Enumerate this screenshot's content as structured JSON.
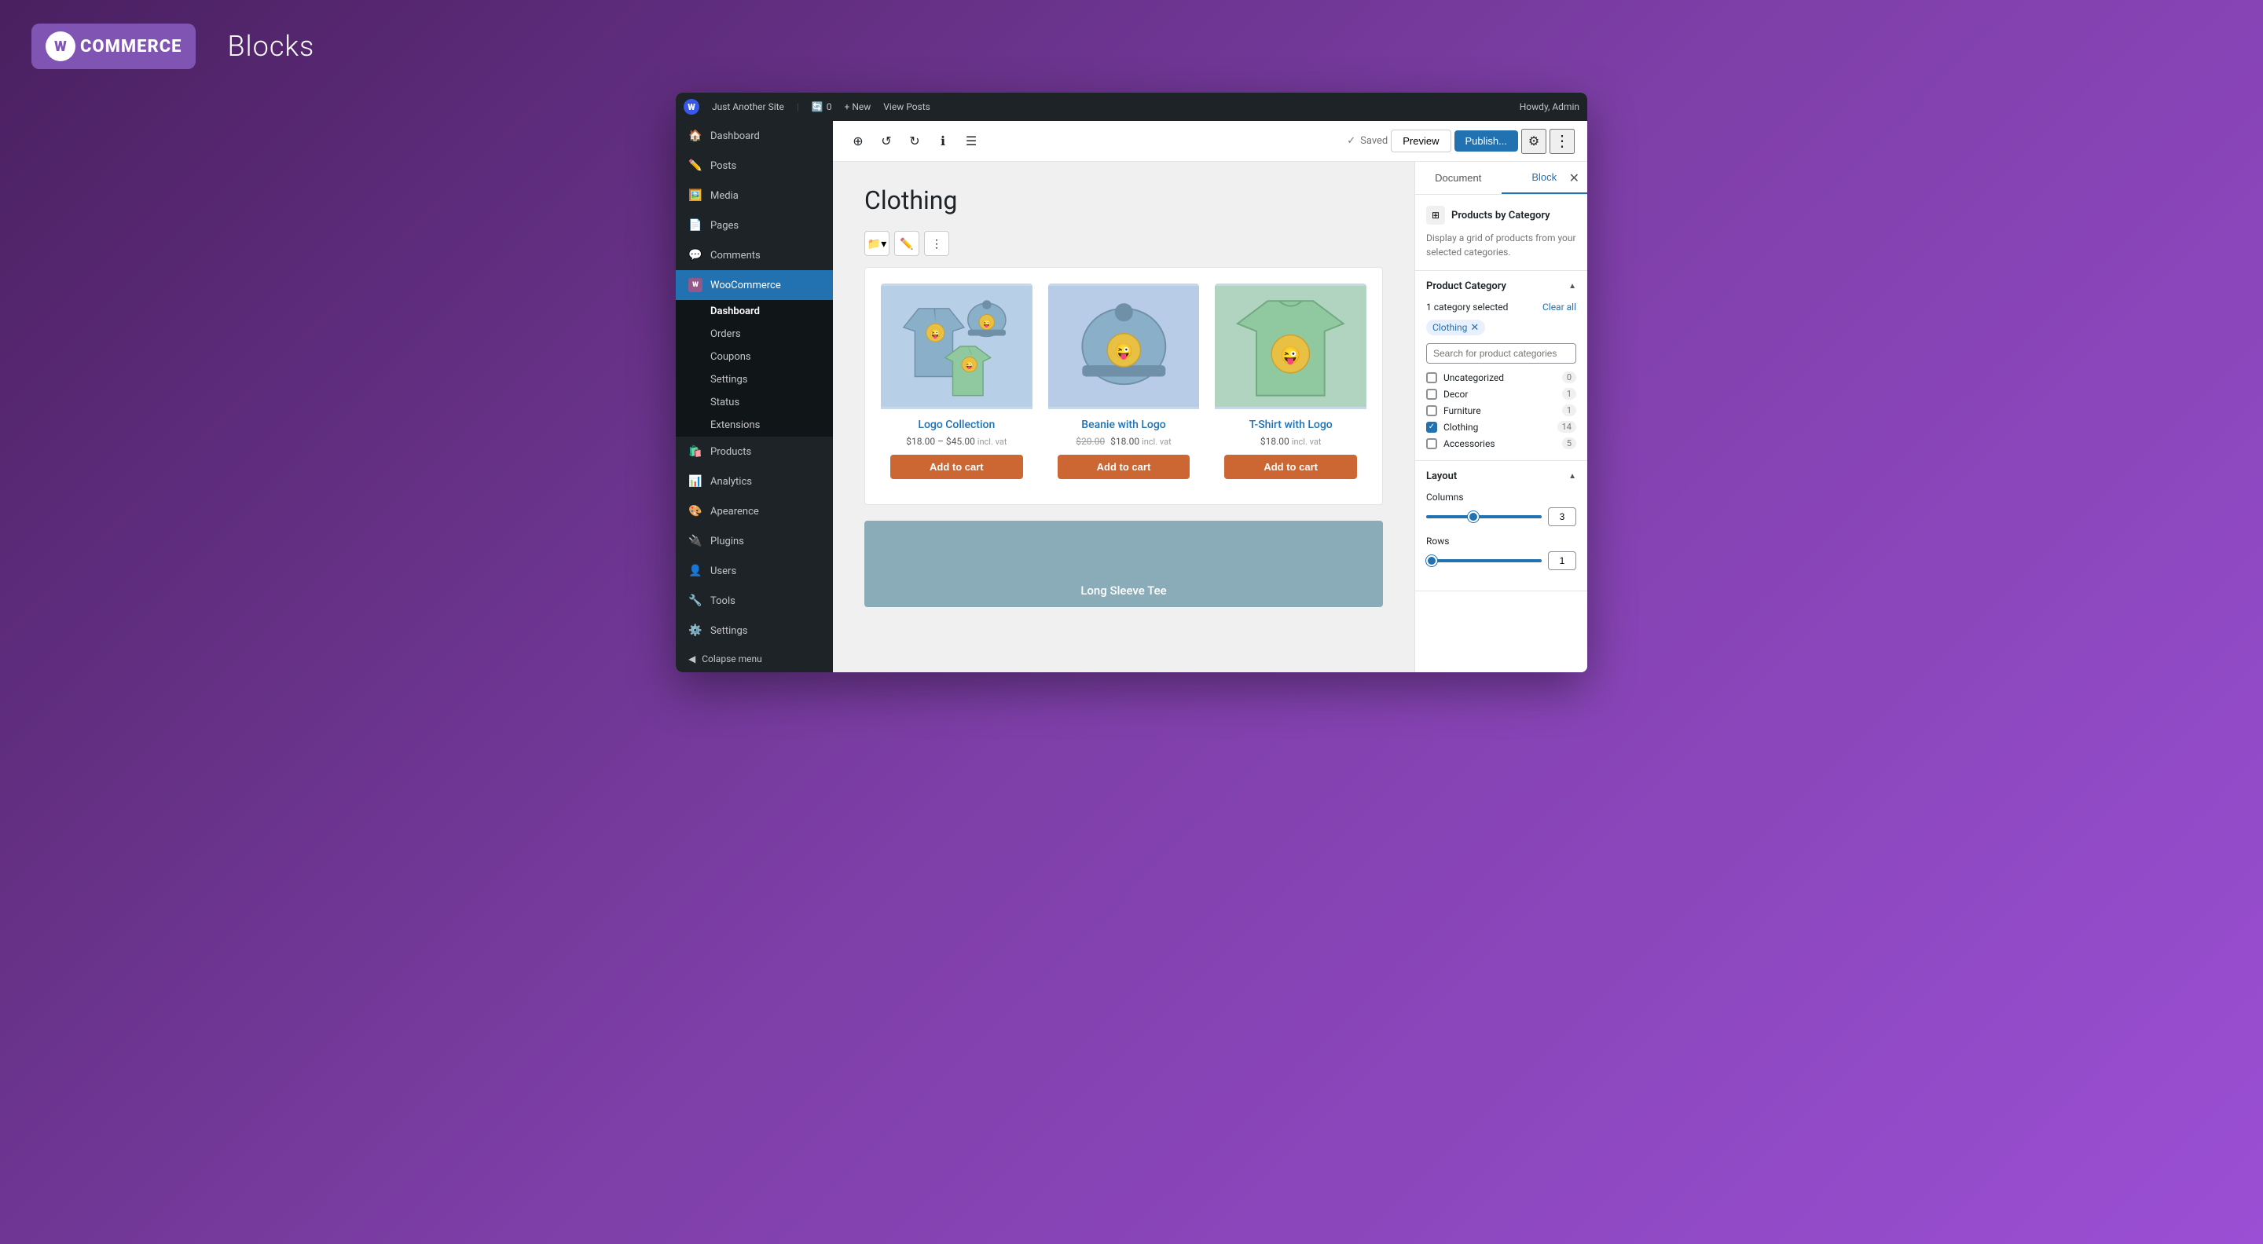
{
  "branding": {
    "logo_text": "COMMERCE",
    "page_title": "Blocks"
  },
  "admin_bar": {
    "site_name": "Just Another Site",
    "updates_count": "0",
    "new_label": "+ New",
    "view_posts_label": "View Posts",
    "howdy": "Howdy, Admin"
  },
  "sidebar": {
    "items": [
      {
        "id": "dashboard",
        "label": "Dashboard",
        "icon": "🏠"
      },
      {
        "id": "posts",
        "label": "Posts",
        "icon": "✏️"
      },
      {
        "id": "media",
        "label": "Media",
        "icon": "🖼️"
      },
      {
        "id": "pages",
        "label": "Pages",
        "icon": "📄"
      },
      {
        "id": "comments",
        "label": "Comments",
        "icon": "💬"
      },
      {
        "id": "woocommerce",
        "label": "WooCommerce",
        "icon": "W"
      },
      {
        "id": "products",
        "label": "Products",
        "icon": "🛍️"
      },
      {
        "id": "analytics",
        "label": "Analytics",
        "icon": "📊"
      },
      {
        "id": "appearance",
        "label": "Apearence",
        "icon": "🎨"
      },
      {
        "id": "plugins",
        "label": "Plugins",
        "icon": "🔌"
      },
      {
        "id": "users",
        "label": "Users",
        "icon": "👤"
      },
      {
        "id": "tools",
        "label": "Tools",
        "icon": "🔧"
      },
      {
        "id": "settings",
        "label": "Settings",
        "icon": "⚙️"
      }
    ],
    "woo_submenu": [
      {
        "id": "woo-dashboard",
        "label": "Dashboard",
        "active": true
      },
      {
        "id": "woo-orders",
        "label": "Orders"
      },
      {
        "id": "woo-coupons",
        "label": "Coupons"
      },
      {
        "id": "woo-settings",
        "label": "Settings"
      },
      {
        "id": "woo-status",
        "label": "Status"
      },
      {
        "id": "woo-extensions",
        "label": "Extensions"
      }
    ],
    "collapse_label": "Colapse menu"
  },
  "toolbar": {
    "saved_label": "Saved",
    "preview_label": "Preview",
    "publish_label": "Publish..."
  },
  "page": {
    "title": "Clothing"
  },
  "products": [
    {
      "name": "Logo Collection",
      "price_from": "$18.00",
      "price_to": "$45.00",
      "price_suffix": "incl. vat",
      "add_to_cart": "Add to cart"
    },
    {
      "name": "Beanie with Logo",
      "original_price": "$20.00",
      "price": "$18.00",
      "price_suffix": "incl. vat",
      "add_to_cart": "Add to cart"
    },
    {
      "name": "T-Shirt with Logo",
      "price": "$18.00",
      "price_suffix": "incl. vat",
      "add_to_cart": "Add to cart"
    }
  ],
  "second_product_label": "Long Sleeve Tee",
  "panel": {
    "document_tab": "Document",
    "block_tab": "Block",
    "block_name": "Products by Category",
    "block_desc": "Display a grid of products from your selected categories.",
    "product_category_section": "Product Category",
    "selected_count": "1 category selected",
    "clear_all": "Clear all",
    "selected_tag": "Clothing",
    "search_placeholder": "Search for product categories",
    "categories": [
      {
        "name": "Uncategorized",
        "count": "0",
        "checked": false
      },
      {
        "name": "Decor",
        "count": "1",
        "checked": false
      },
      {
        "name": "Furniture",
        "count": "1",
        "checked": false
      },
      {
        "name": "Clothing",
        "count": "14",
        "checked": true
      },
      {
        "name": "Accessories",
        "count": "5",
        "checked": false
      }
    ],
    "layout_section": "Layout",
    "columns_label": "Columns",
    "columns_value": "3",
    "rows_label": "Rows",
    "rows_value": "1"
  }
}
